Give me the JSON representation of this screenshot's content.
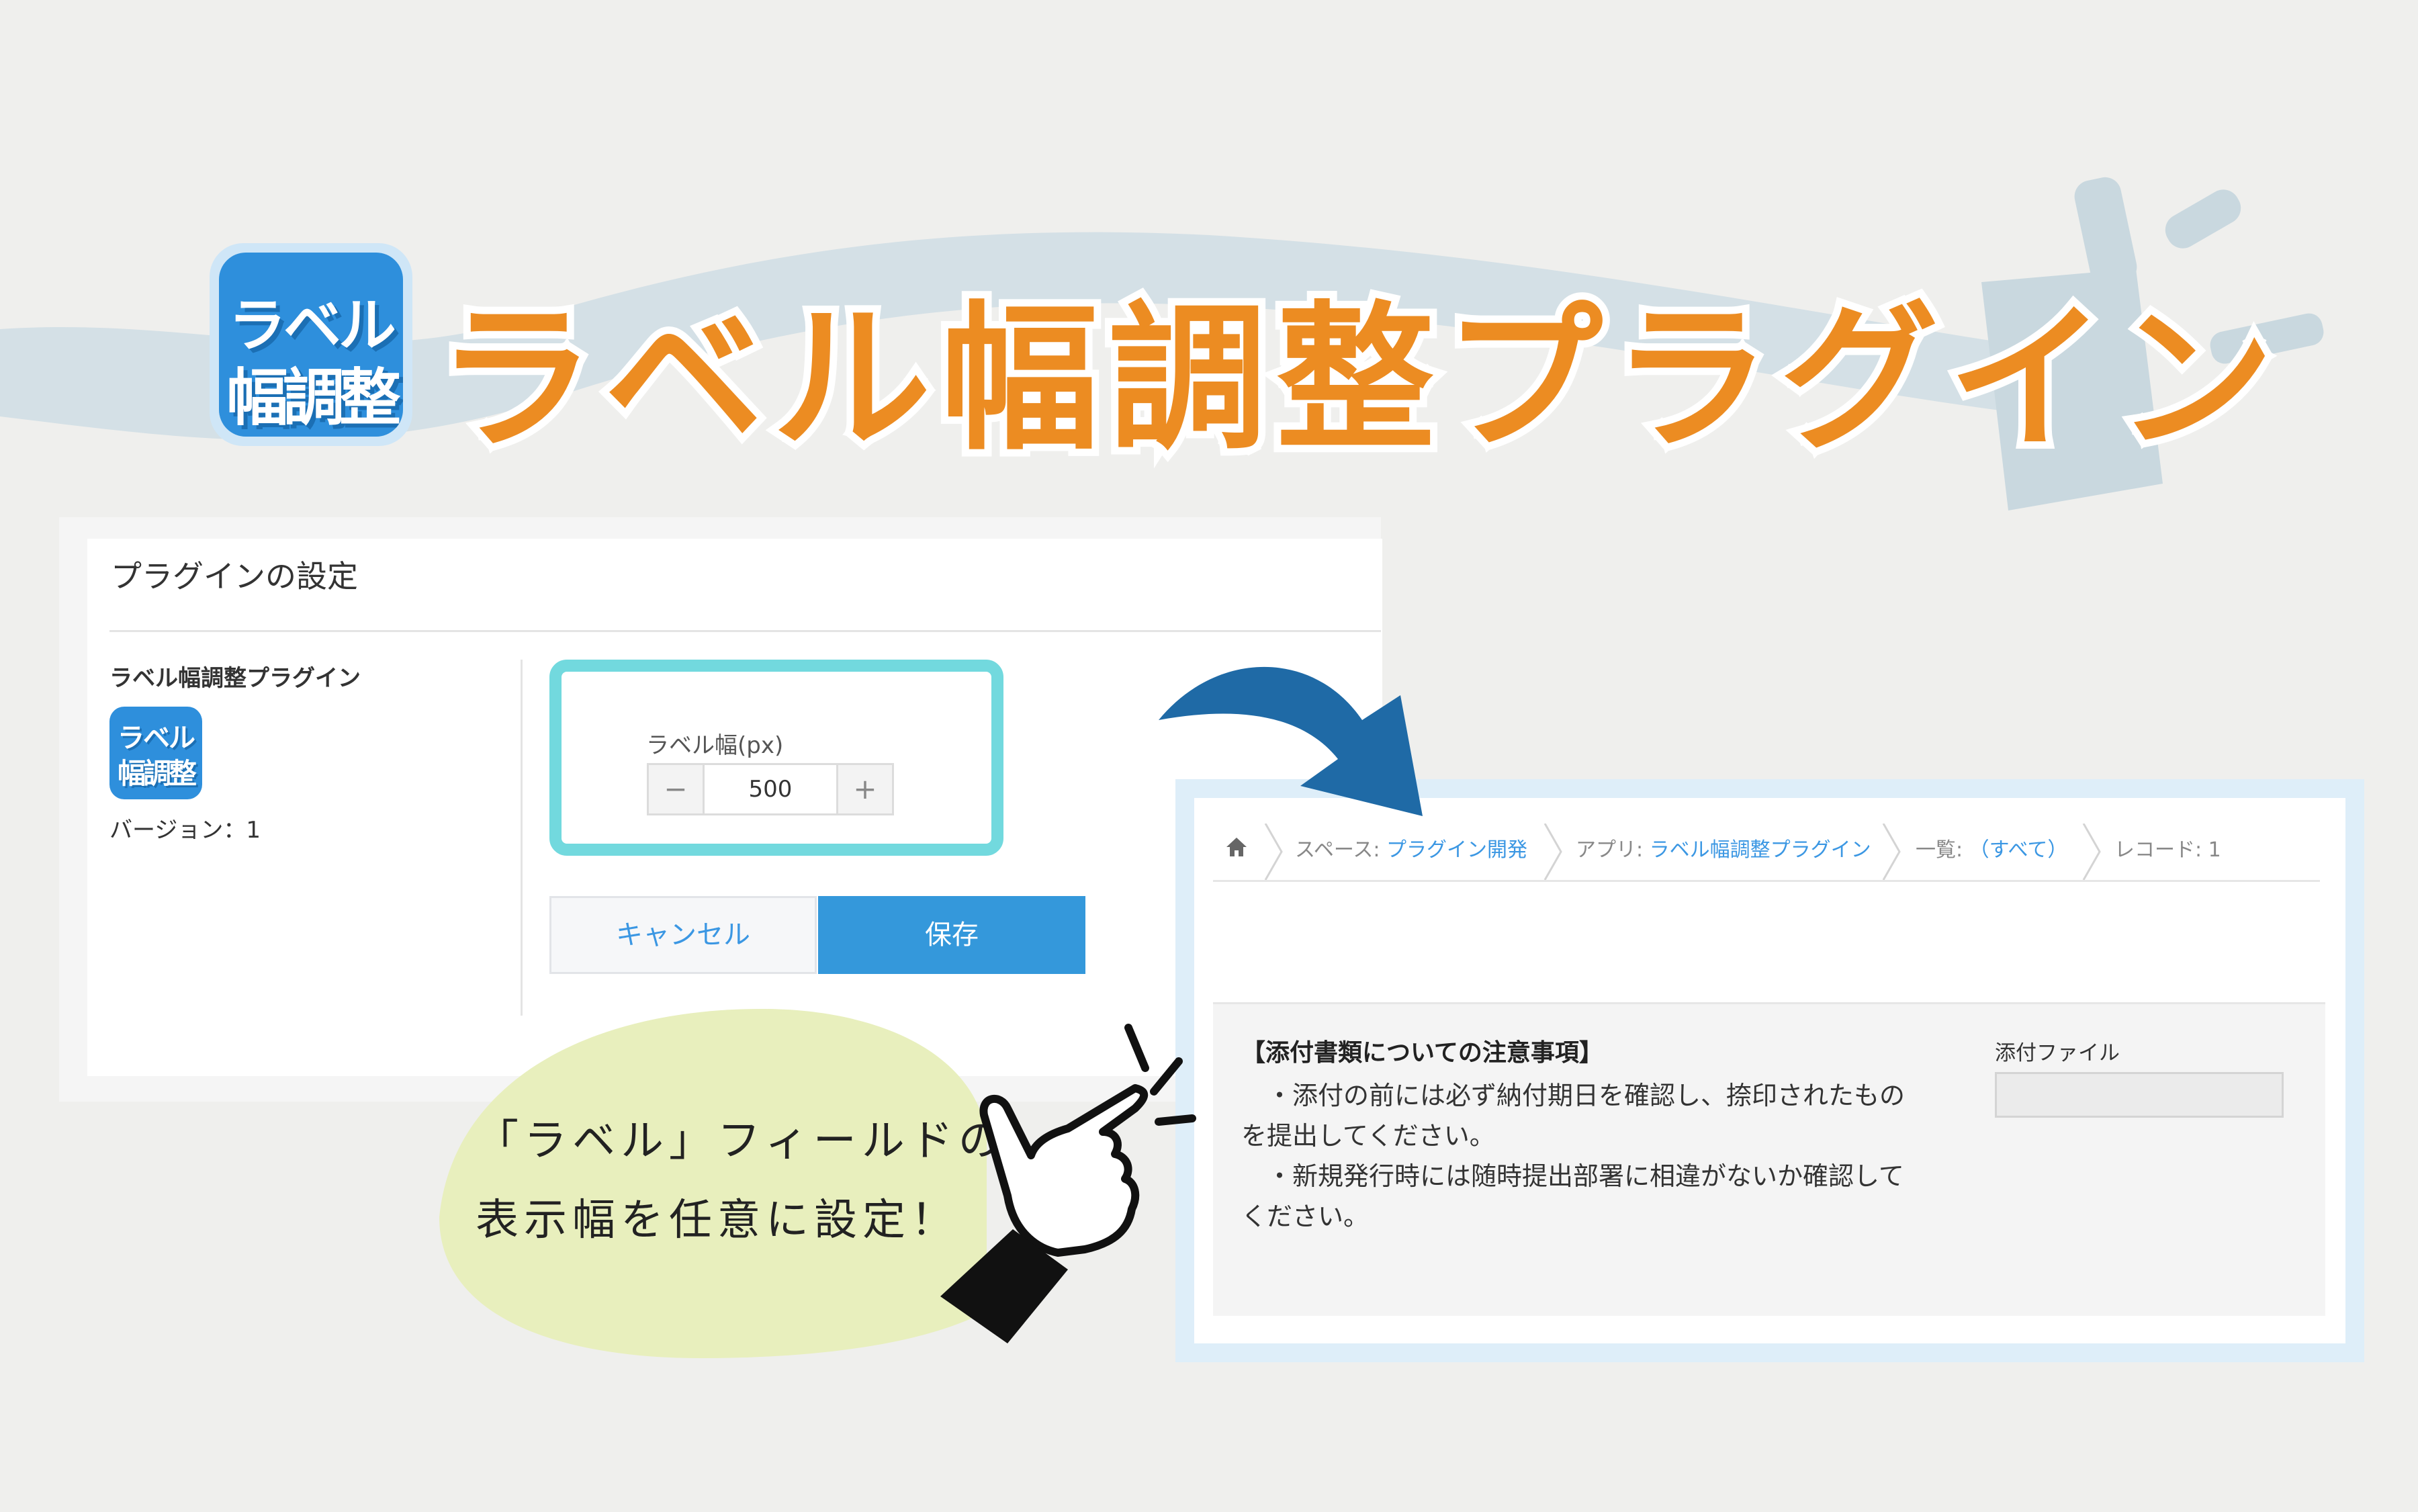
{
  "title": {
    "icon_line1": "ラベル",
    "icon_line2": "幅調整",
    "main": "ラベル幅調整プラグイン"
  },
  "settings": {
    "header": "プラグインの設定",
    "plugin_name": "ラベル幅調整プラグイン",
    "icon_line1": "ラベル",
    "icon_line2": "幅調整",
    "version": "バージョン：1",
    "width_label": "ラベル幅(px)",
    "width_value": "500",
    "minus": "−",
    "plus": "+",
    "cancel_label": "キャンセル",
    "save_label": "保存"
  },
  "bubble": {
    "line1": "「ラベル」フィールドの",
    "line2": "表示幅を任意に設定！"
  },
  "record": {
    "breadcrumb": {
      "space_prefix": "スペース: ",
      "space": "プラグイン開発",
      "app_prefix": "アプリ: ",
      "app": "ラベル幅調整プラグイン",
      "list_prefix": "一覧: ",
      "list": "（すべて）",
      "record": "レコード: 1"
    },
    "notice_title": "【添付書類についての注意事項】",
    "notice_lines": [
      "　・添付の前には必ず納付期日を確認し、捺印されたもの",
      "を提出してください。",
      "　・新規発行時には随時提出部署に相違がないか確認して",
      "ください。"
    ],
    "attach_label": "添付ファイル"
  },
  "colors": {
    "title_orange": "#ec8c22",
    "icon_blue": "#2e8fdc",
    "highlight_cyan": "#72d9de",
    "save_blue": "#3498db",
    "arrow_blue": "#1f6aa6",
    "bubble_green": "#e8efbd"
  }
}
